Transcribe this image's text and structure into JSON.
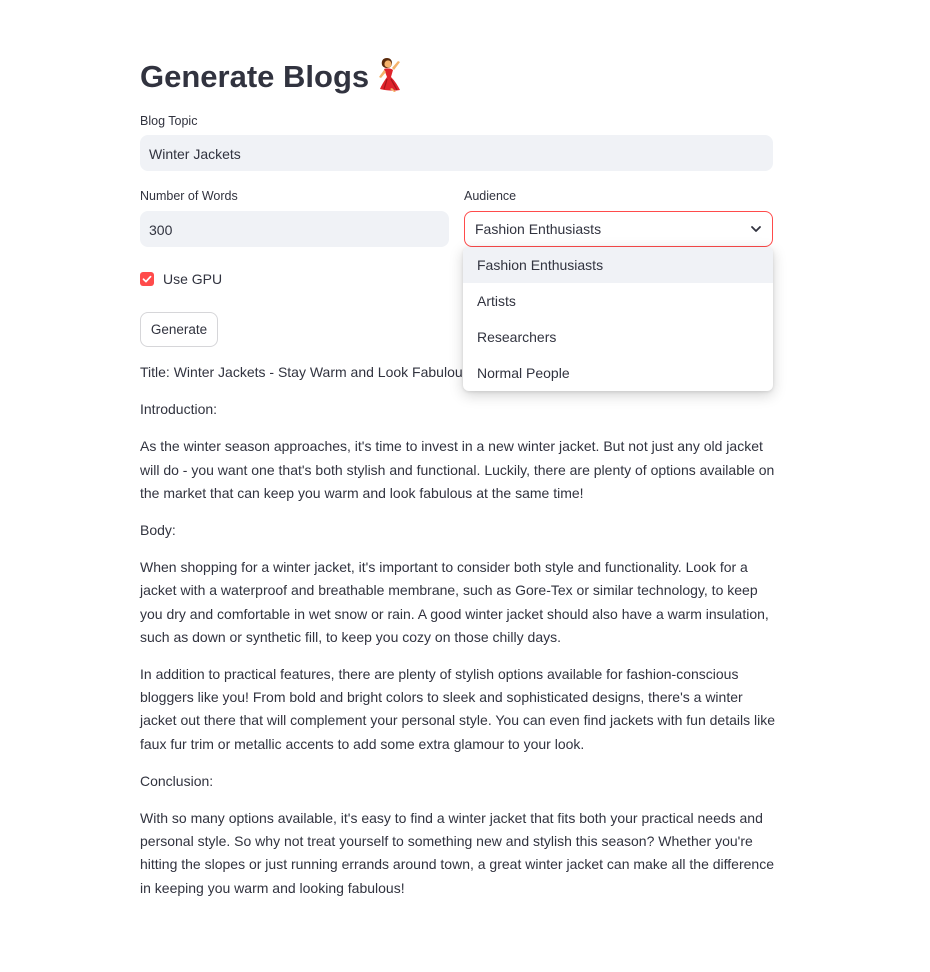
{
  "page": {
    "title": "Generate Blogs",
    "title_emoji": "woman-dancing-icon"
  },
  "form": {
    "topic_label": "Blog Topic",
    "topic_value": "Winter Jackets",
    "words_label": "Number of Words",
    "words_value": "300",
    "audience_label": "Audience",
    "audience_value": "Fashion Enthusiasts",
    "audience_options": [
      {
        "label": "Fashion Enthusiasts"
      },
      {
        "label": "Artists"
      },
      {
        "label": "Researchers"
      },
      {
        "label": "Normal People"
      }
    ],
    "gpu_label": "Use GPU",
    "gpu_checked": true,
    "generate_label": "Generate"
  },
  "output": {
    "paragraphs": [
      "Title: Winter Jackets - Stay Warm and Look Fabulous T",
      "Introduction:",
      "As the winter season approaches, it's time to invest in a new winter jacket. But not just any old jacket will do - you want one that's both stylish and functional. Luckily, there are plenty of options available on the market that can keep you warm and look fabulous at the same time!",
      "Body:",
      "When shopping for a winter jacket, it's important to consider both style and functionality. Look for a jacket with a waterproof and breathable membrane, such as Gore-Tex or similar technology, to keep you dry and comfortable in wet snow or rain. A good winter jacket should also have a warm insulation, such as down or synthetic fill, to keep you cozy on those chilly days.",
      "In addition to practical features, there are plenty of stylish options available for fashion-conscious bloggers like you! From bold and bright colors to sleek and sophisticated designs, there's a winter jacket out there that will complement your personal style. You can even find jackets with fun details like faux fur trim or metallic accents to add some extra glamour to your look.",
      "Conclusion:",
      "With so many options available, it's easy to find a winter jacket that fits both your practical needs and personal style. So why not treat yourself to something new and stylish this season? Whether you're hitting the slopes or just running errands around town, a great winter jacket can make all the difference in keeping you warm and looking fabulous!"
    ]
  },
  "colors": {
    "accent": "#ff4b4b",
    "input_bg": "#f0f2f6",
    "text": "#31333f"
  }
}
